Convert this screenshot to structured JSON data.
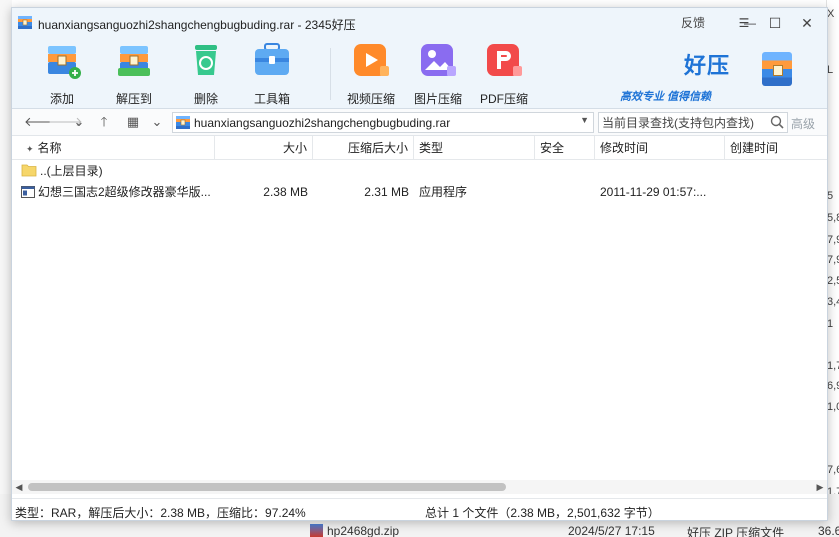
{
  "window": {
    "title": "huanxiangsanguozhi2shangchengbugbuding.rar - 2345好压",
    "feedback_label": "反馈",
    "menu_glyph": "☰",
    "minimize_glyph": "—",
    "maximize_glyph": "☐",
    "close_glyph": "✕"
  },
  "toolbar": {
    "tools": [
      {
        "label": "添加",
        "icon": "add-archive-icon"
      },
      {
        "label": "解压到",
        "icon": "extract-to-icon"
      },
      {
        "label": "删除",
        "icon": "delete-icon"
      },
      {
        "label": "工具箱",
        "icon": "toolbox-icon"
      },
      {
        "label": "视频压缩",
        "icon": "video-compress-icon"
      },
      {
        "label": "图片压缩",
        "icon": "image-compress-icon"
      },
      {
        "label": "PDF压缩",
        "icon": "pdf-compress-icon"
      }
    ],
    "brand": "好压",
    "slogan": "高效专业  值得信赖"
  },
  "addressbar": {
    "back": "🡐",
    "forward": "🡒",
    "history": "⌄",
    "up": "🡑",
    "view": "▦",
    "view_dropdown": "⌄",
    "path": "huanxiangsanguozhi2shangchengbugbuding.rar",
    "path_dropdown": "▼",
    "search_placeholder": "当前目录查找(支持包内查找)",
    "advanced_label": "高级"
  },
  "columns": {
    "sort_glyph": "✦",
    "name": "名称",
    "size": "大小",
    "packed": "压缩后大小",
    "type": "类型",
    "security": "安全",
    "modified": "修改时间",
    "created": "创建时间"
  },
  "files": [
    {
      "name": "..(上层目录)",
      "size": "",
      "packed": "",
      "type": "",
      "security": "",
      "modified": "",
      "created": "",
      "icon": "folder-up-icon"
    },
    {
      "name": "幻想三国志2超级修改器豪华版...",
      "size": "2.38 MB",
      "packed": "2.31 MB",
      "type": "应用程序",
      "security": "",
      "modified": "2011-11-29 01:57:...",
      "created": "",
      "icon": "exe-file-icon"
    }
  ],
  "scrollbar": {
    "left_glyph": "◀",
    "right_glyph": "▶"
  },
  "status": {
    "left": "类型：RAR，解压后大小：2.38 MB，压缩比：97.24%",
    "right": "总计 1 个文件（2.38 MB，2,501,632 字节）"
  },
  "background": {
    "right_edge": [
      "X",
      "L",
      "5",
      "5,8",
      "7,9",
      "7,9",
      "2,5",
      "3,4",
      "1",
      "1,7",
      "6,9",
      "1,0",
      "7,6",
      "1,7",
      "36.6"
    ],
    "bottom_row": {
      "name": "hp2468gd.zip",
      "date": "2024/5/27 17:15",
      "type": "好压 ZIP 压缩文件",
      "size": "36.6"
    }
  },
  "colors": {
    "titlebar_bg": "#eef5fb",
    "brand_blue": "#1e73d6"
  }
}
